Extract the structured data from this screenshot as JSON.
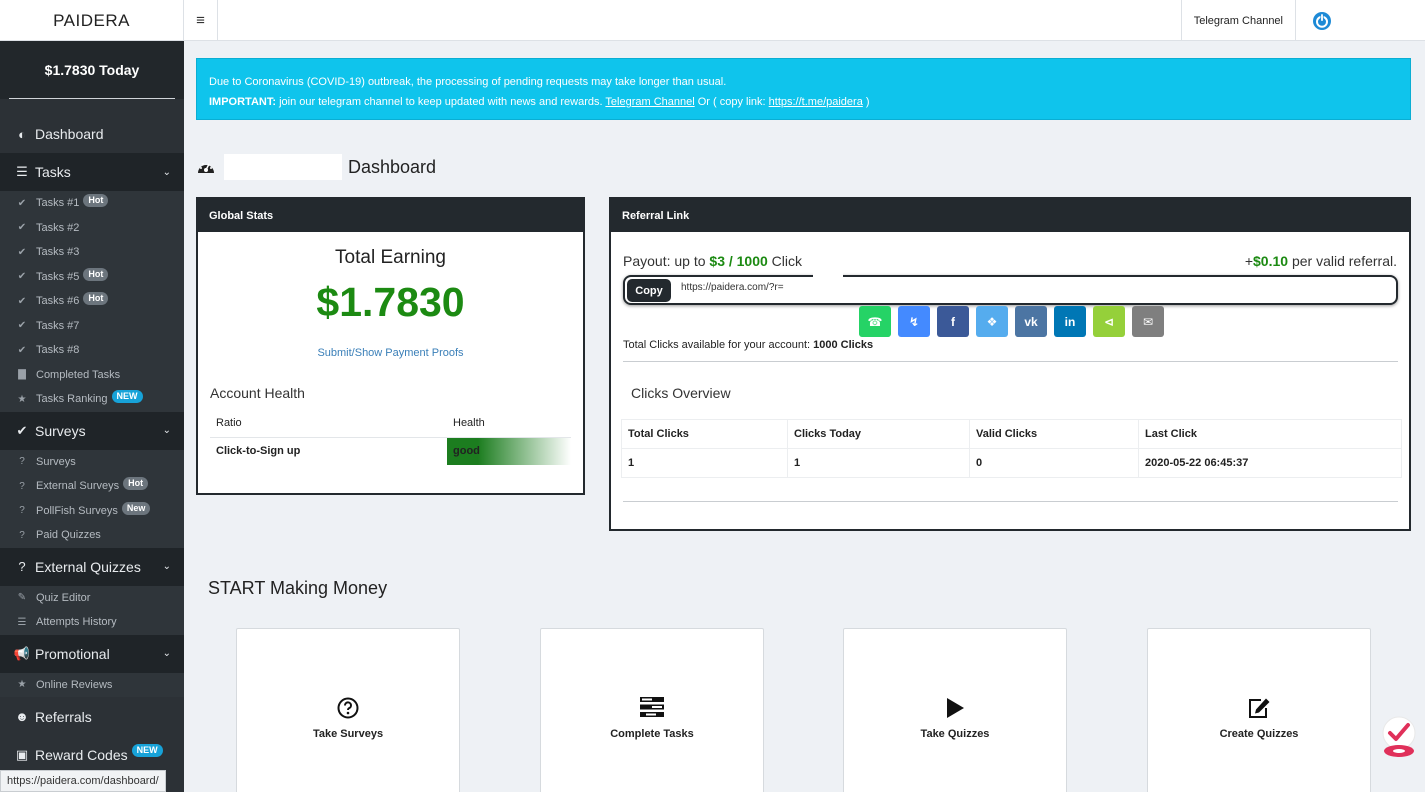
{
  "topbar": {
    "brand": "PAIDERA",
    "menu_icon": "≡",
    "telegram_label": "Telegram Channel"
  },
  "sidebar": {
    "today": "$1.7830 Today",
    "dashboard": "Dashboard",
    "tasks": {
      "label": "Tasks",
      "items": [
        {
          "label": "Tasks #1",
          "badge": "Hot"
        },
        {
          "label": "Tasks #2",
          "badge": ""
        },
        {
          "label": "Tasks #3",
          "badge": ""
        },
        {
          "label": "Tasks #5",
          "badge": "Hot"
        },
        {
          "label": "Tasks #6",
          "badge": "Hot"
        },
        {
          "label": "Tasks #7",
          "badge": ""
        },
        {
          "label": "Tasks #8",
          "badge": ""
        },
        {
          "label": "Completed Tasks",
          "badge": ""
        },
        {
          "label": "Tasks Ranking",
          "badge": "NEW"
        }
      ]
    },
    "surveys": {
      "label": "Surveys",
      "items": [
        {
          "label": "Surveys",
          "badge": ""
        },
        {
          "label": "External Surveys",
          "badge": "Hot"
        },
        {
          "label": "PollFish Surveys",
          "badge": "New"
        },
        {
          "label": "Paid Quizzes",
          "badge": ""
        }
      ]
    },
    "quizzes": {
      "label": "External Quizzes",
      "items": [
        {
          "label": "Quiz Editor"
        },
        {
          "label": "Attempts History"
        }
      ]
    },
    "promotional": {
      "label": "Promotional",
      "items": [
        {
          "label": "Online Reviews"
        }
      ]
    },
    "referrals": "Referrals",
    "reward_codes": "Reward Codes",
    "reward_badge": "NEW"
  },
  "status_url": "https://paidera.com/dashboard/",
  "alert": {
    "line1": "Due to Coronavirus (COVID-19) outbreak, the processing of pending requests may take longer than usual.",
    "important": "IMPORTANT:",
    "line2": " join our telegram channel to keep updated with news and rewards. ",
    "tg_link": "Telegram Channel",
    "or_copy": " Or ( copy link: ",
    "tg_url": "https://t.me/paidera",
    "close": " )"
  },
  "page_title": "Dashboard",
  "global_stats": {
    "header": "Global Stats",
    "total_label": "Total Earning",
    "total_value": "$1.7830",
    "proofs_link": "Submit/Show Payment Proofs",
    "health_title": "Account Health",
    "col_ratio": "Ratio",
    "col_health": "Health",
    "row_ratio": "Click-to-Sign up",
    "row_health": "good"
  },
  "referral": {
    "header": "Referral Link",
    "payout_prefix": "Payout: up to ",
    "payout_value": "$3 / 1000",
    "payout_suffix": " Click",
    "per_prefix": "+",
    "per_value": "$0.10",
    "per_suffix": " per valid referral.",
    "copy_label": "Copy",
    "link": "https://paidera.com/?r=",
    "total_clicks_label": "Total Clicks available for your account: ",
    "total_clicks_value": "1000 Clicks",
    "overview_title": "Clicks Overview",
    "columns": [
      "Total Clicks",
      "Clicks Today",
      "Valid Clicks",
      "Last Click"
    ],
    "row": [
      "1",
      "1",
      "0",
      "2020-05-22 06:45:37"
    ],
    "share_colors": [
      "#25d366",
      "#448aff",
      "#3b5998",
      "#55acee",
      "#4c75a3",
      "#0077b5",
      "#95d03a",
      "#7f7f7f"
    ]
  },
  "start_title": "START Making Money",
  "tiles": [
    {
      "label": "Take Surveys",
      "icon": "question-circle-icon"
    },
    {
      "label": "Complete Tasks",
      "icon": "tasks-list-icon"
    },
    {
      "label": "Take Quizzes",
      "icon": "play-icon"
    },
    {
      "label": "Create Quizzes",
      "icon": "edit-icon"
    }
  ]
}
